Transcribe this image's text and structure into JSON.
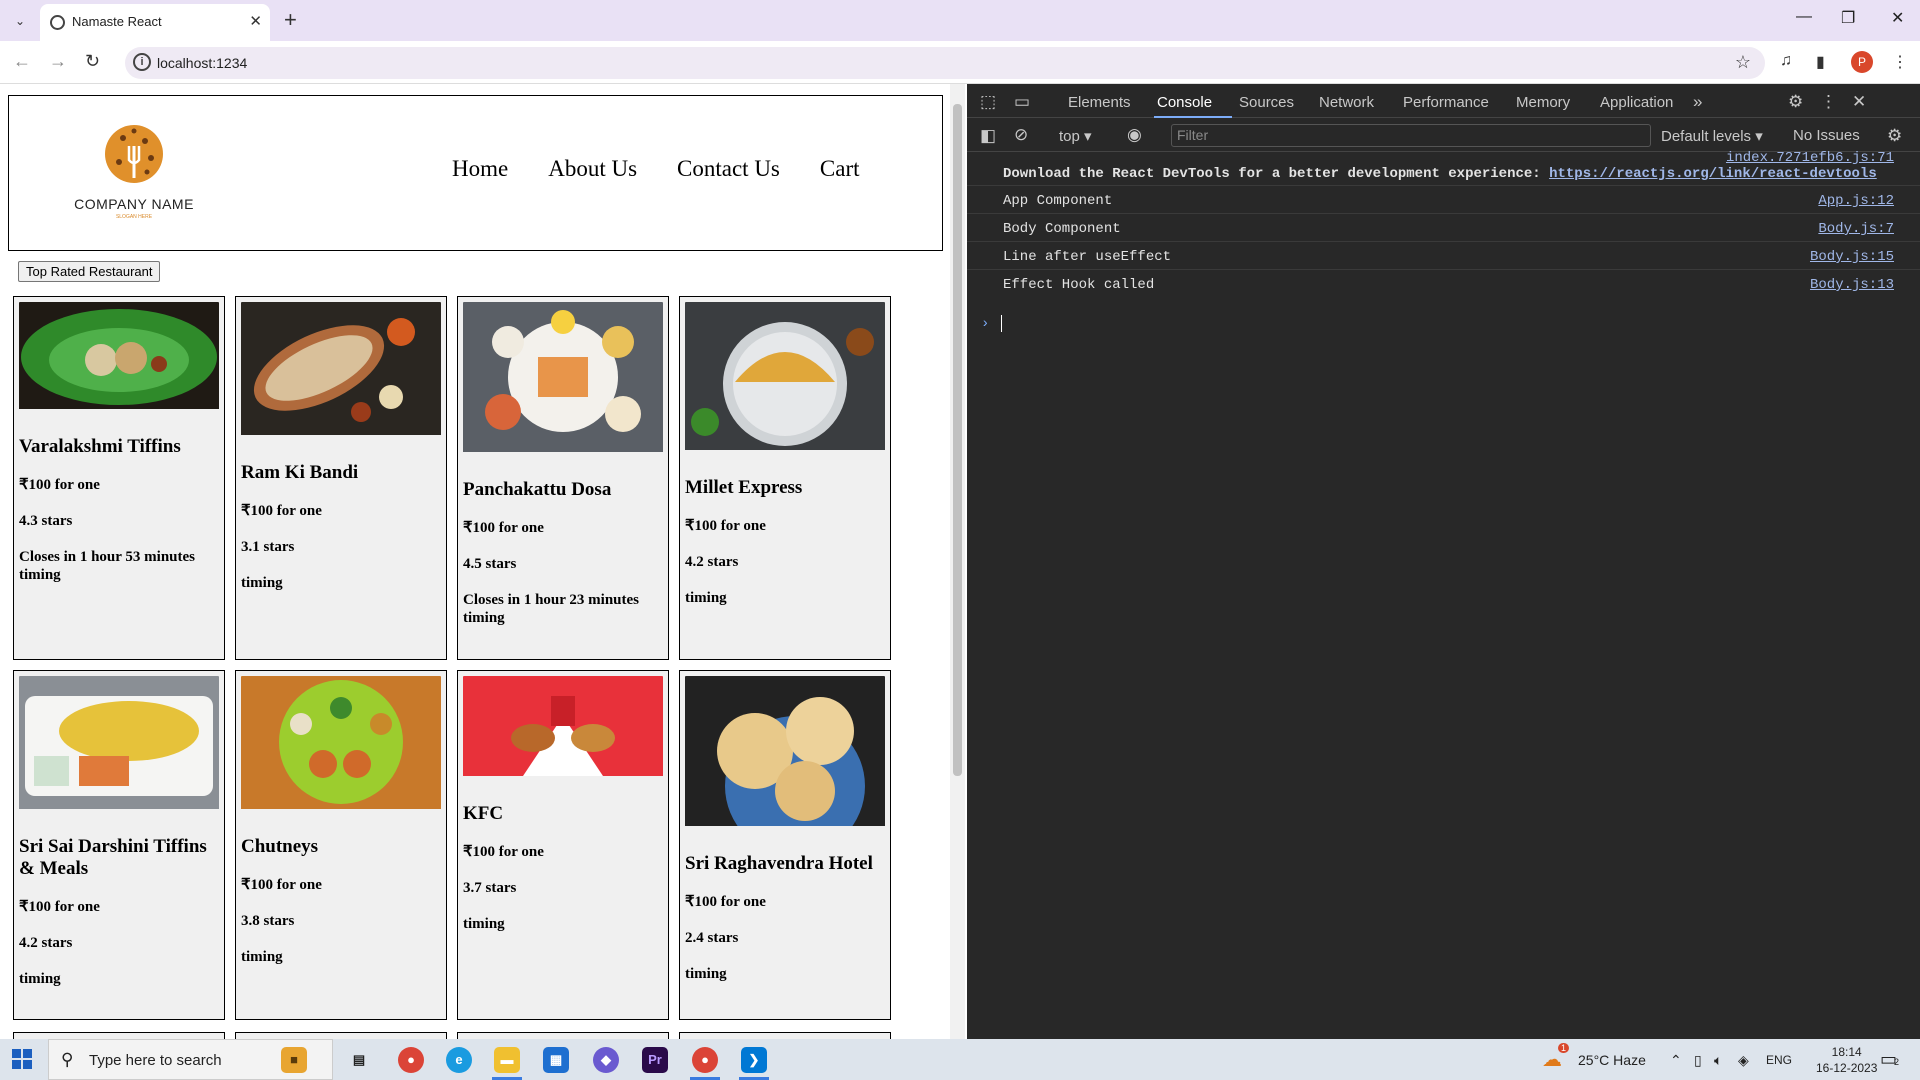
{
  "browser": {
    "tab_title": "Namaste React",
    "url": "localhost:1234",
    "profile_initial": "P"
  },
  "app": {
    "logo": {
      "company": "COMPANY NAME",
      "slogan": "SLOGAN HERE"
    },
    "nav": [
      "Home",
      "About Us",
      "Contact Us",
      "Cart"
    ],
    "filter_button": "Top Rated Restaurant",
    "restaurants": [
      {
        "name": "Varalakshmi Tiffins",
        "price": "₹100 for one",
        "rating": "4.3 stars",
        "closes": "Closes in 1 hour 53 minutes",
        "timing": "timing",
        "image": "idli-on-banana-leaf"
      },
      {
        "name": "Ram Ki Bandi",
        "price": "₹100 for one",
        "rating": "3.1 stars",
        "closes": "",
        "timing": "timing",
        "image": "long-dosa-with-chutneys"
      },
      {
        "name": "Panchakattu Dosa",
        "price": "₹100 for one",
        "rating": "4.5 stars",
        "closes": "Closes in 1 hour 23 minutes",
        "timing": "timing",
        "image": "dosa-platter"
      },
      {
        "name": "Millet Express",
        "price": "₹100 for one",
        "rating": "4.2 stars",
        "closes": "",
        "timing": "timing",
        "image": "masala-dosa-plate"
      },
      {
        "name": "Sri Sai Darshini Tiffins & Meals",
        "price": "₹100 for one",
        "rating": "4.2 stars",
        "closes": "",
        "timing": "timing",
        "image": "lemon-rice"
      },
      {
        "name": "Chutneys",
        "price": "₹100 for one",
        "rating": "3.8 stars",
        "closes": "",
        "timing": "timing",
        "image": "thali-on-leaf"
      },
      {
        "name": "KFC",
        "price": "₹100 for one",
        "rating": "3.7 stars",
        "closes": "",
        "timing": "timing",
        "image": "kfc-meal"
      },
      {
        "name": "Sri Raghavendra Hotel",
        "price": "₹100 for one",
        "rating": "2.4 stars",
        "closes": "",
        "timing": "timing",
        "image": "poori"
      }
    ]
  },
  "devtools": {
    "tabs": [
      "Elements",
      "Console",
      "Sources",
      "Network",
      "Performance",
      "Memory",
      "Application"
    ],
    "active_tab": "Console",
    "context": "top",
    "filter_placeholder": "Filter",
    "levels": "Default levels",
    "issues": "No Issues",
    "logs": [
      {
        "message": "Download the React DevTools for a better development experience: ",
        "link": "https://reactjs.org/link/react-devtools",
        "source": "index.7271efb6.js:71"
      },
      {
        "message": "App Component",
        "source": "App.js:12"
      },
      {
        "message": "Body Component",
        "source": "Body.js:7"
      },
      {
        "message": "Line after useEffect",
        "source": "Body.js:15"
      },
      {
        "message": "Effect Hook called",
        "source": "Body.js:13"
      }
    ]
  },
  "taskbar": {
    "search_placeholder": "Type here to search",
    "weather": "25°C  Haze",
    "language": "ENG",
    "time": "18:14",
    "date": "16-12-2023",
    "notification_count": "2",
    "weather_badge": "1"
  },
  "colors": {
    "devtools_bg": "#282828",
    "accent": "#7cacf8",
    "tabbar": "#e9e1f5"
  }
}
